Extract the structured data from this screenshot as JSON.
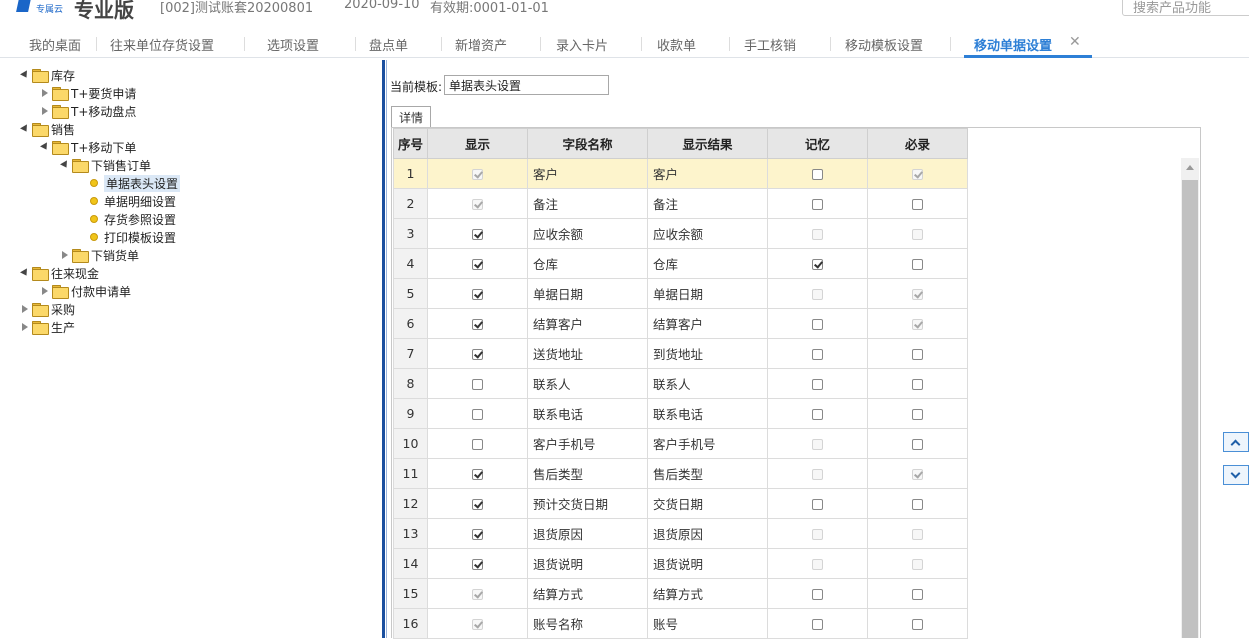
{
  "header": {
    "logo_sub": "专属云",
    "logo_text": "专业版",
    "account": "[002]测试账套20200801",
    "date": "2020-09-10",
    "validity": "有效期:0001-01-01",
    "search_placeholder": "搜索产品功能"
  },
  "tabs": [
    {
      "label": "我的桌面"
    },
    {
      "label": "往来单位存货设置"
    },
    {
      "label": "选项设置"
    },
    {
      "label": "盘点单"
    },
    {
      "label": "新增资产"
    },
    {
      "label": "录入卡片"
    },
    {
      "label": "收款单"
    },
    {
      "label": "手工核销"
    },
    {
      "label": "移动模板设置"
    },
    {
      "label": "移动单据设置"
    }
  ],
  "tree": [
    {
      "label": "库存"
    },
    {
      "label": "T+要货申请"
    },
    {
      "label": "T+移动盘点"
    },
    {
      "label": "销售"
    },
    {
      "label": "T+移动下单"
    },
    {
      "label": "下销售订单"
    },
    {
      "label": "单据表头设置"
    },
    {
      "label": "单据明细设置"
    },
    {
      "label": "存货参照设置"
    },
    {
      "label": "打印模板设置"
    },
    {
      "label": "下销货单"
    },
    {
      "label": "往来现金"
    },
    {
      "label": "付款申请单"
    },
    {
      "label": "采购"
    },
    {
      "label": "生产"
    }
  ],
  "template": {
    "label": "当前模板:",
    "value": "单据表头设置",
    "detail_tab": "详情"
  },
  "grid": {
    "headers": [
      "序号",
      "显示",
      "字段名称",
      "显示结果",
      "记忆",
      "必录"
    ],
    "rows": [
      {
        "idx": "1",
        "field": "客户",
        "result": "客户"
      },
      {
        "idx": "2",
        "field": "备注",
        "result": "备注"
      },
      {
        "idx": "3",
        "field": "应收余额",
        "result": "应收余额"
      },
      {
        "idx": "4",
        "field": "仓库",
        "result": "仓库"
      },
      {
        "idx": "5",
        "field": "单据日期",
        "result": "单据日期"
      },
      {
        "idx": "6",
        "field": "结算客户",
        "result": "结算客户"
      },
      {
        "idx": "7",
        "field": "送货地址",
        "result": "到货地址"
      },
      {
        "idx": "8",
        "field": "联系人",
        "result": "联系人"
      },
      {
        "idx": "9",
        "field": "联系电话",
        "result": "联系电话"
      },
      {
        "idx": "10",
        "field": "客户手机号",
        "result": "客户手机号"
      },
      {
        "idx": "11",
        "field": "售后类型",
        "result": "售后类型"
      },
      {
        "idx": "12",
        "field": "预计交货日期",
        "result": "交货日期"
      },
      {
        "idx": "13",
        "field": "退货原因",
        "result": "退货原因"
      },
      {
        "idx": "14",
        "field": "退货说明",
        "result": "退货说明"
      },
      {
        "idx": "15",
        "field": "结算方式",
        "result": "结算方式"
      },
      {
        "idx": "16",
        "field": "账号名称",
        "result": "账号"
      }
    ]
  }
}
